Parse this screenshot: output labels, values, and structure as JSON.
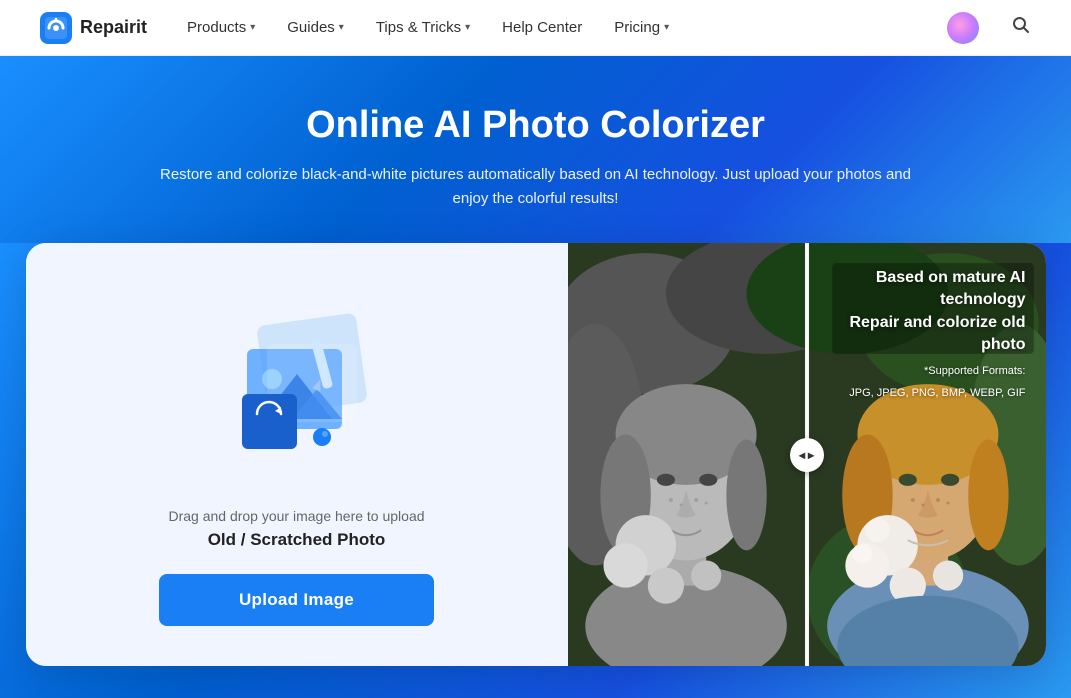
{
  "navbar": {
    "logo_text": "Repairit",
    "nav_items": [
      {
        "label": "Products",
        "has_dropdown": true
      },
      {
        "label": "Guides",
        "has_dropdown": true
      },
      {
        "label": "Tips & Tricks",
        "has_dropdown": true
      },
      {
        "label": "Help Center",
        "has_dropdown": false
      },
      {
        "label": "Pricing",
        "has_dropdown": true
      }
    ]
  },
  "hero": {
    "title": "Online AI Photo Colorizer",
    "subtitle": "Restore and colorize black-and-white pictures automatically based on AI technology. Just upload your photos and enjoy the colorful results!"
  },
  "upload_panel": {
    "drag_text": "Drag and drop your image here to upload",
    "label": "Old / Scratched Photo",
    "button_label": "Upload Image"
  },
  "preview_panel": {
    "title_line1": "Based on mature AI technology",
    "title_line2": "Repair and colorize old photo",
    "formats_label": "*Supported Formats:",
    "formats_list": "JPG, JPEG, PNG, BMP, WEBP, GIF"
  }
}
